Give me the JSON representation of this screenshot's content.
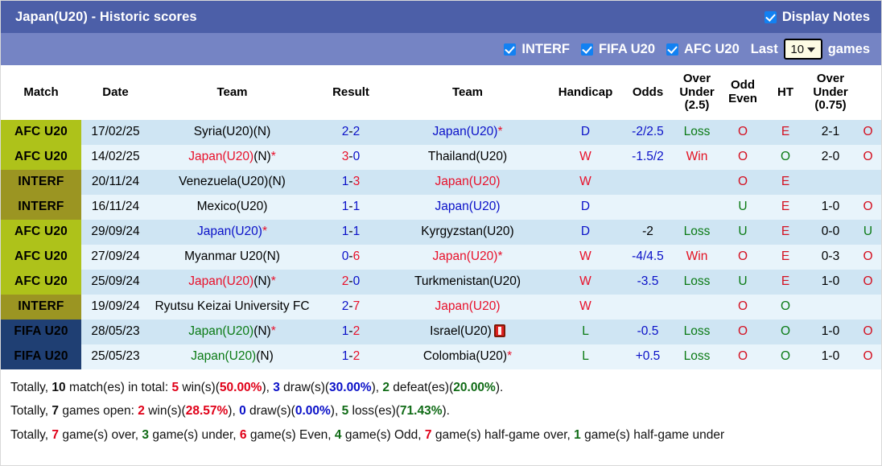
{
  "titlebar": {
    "title": "Japan(U20) - Historic scores",
    "display_notes_label": "Display Notes",
    "display_notes_checked": true
  },
  "filterbar": {
    "filters": [
      {
        "label": "INTERF",
        "checked": true
      },
      {
        "label": "FIFA U20",
        "checked": true
      },
      {
        "label": "AFC U20",
        "checked": true
      }
    ],
    "last_label": "Last",
    "games_label": "games",
    "select_value": "10"
  },
  "table": {
    "headers": [
      "Match",
      "Date",
      "Team",
      "Result",
      "Team",
      "Handicap",
      "Odds",
      "Over\nUnder\n(2.5)",
      "Odd\nEven",
      "HT",
      "Over\nUnder\n(0.75)"
    ],
    "headers_flat": {
      "match": "Match",
      "date": "Date",
      "team_home": "Team",
      "result": "Result",
      "team_away": "Team",
      "handicap": "Handicap",
      "odds": "Odds",
      "ou25_l1": "Over",
      "ou25_l2": "Under",
      "ou25_l3": "(2.5)",
      "oe_l1": "Odd",
      "oe_l2": "Even",
      "ht": "HT",
      "ou075_l1": "Over",
      "ou075_l2": "Under",
      "ou075_l3": "(0.75)"
    },
    "rows": [
      {
        "match": "AFC U20",
        "match_type": "afc",
        "date": "17/02/25",
        "home": {
          "name": "Syria(U20)",
          "color": "black",
          "suffix": "(N)",
          "star": false
        },
        "score": {
          "home": "2",
          "away": "2",
          "home_color": "blue",
          "away_color": "blue"
        },
        "away": {
          "name": "Japan(U20)",
          "color": "blue",
          "suffix": "",
          "star": true,
          "redcard": false
        },
        "wdl": "D",
        "wdl_color": "blue",
        "handicap": "-2/2.5",
        "handicap_color": "blue",
        "odds": "Loss",
        "odds_color": "loss",
        "ou25": "O",
        "oe": "E",
        "ht": "2-1",
        "ou075": "O"
      },
      {
        "match": "AFC U20",
        "match_type": "afc",
        "date": "14/02/25",
        "home": {
          "name": "Japan(U20)",
          "color": "red",
          "suffix": "(N)",
          "star": true
        },
        "score": {
          "home": "3",
          "away": "0",
          "home_color": "red",
          "away_color": "blue"
        },
        "away": {
          "name": "Thailand(U20)",
          "color": "black",
          "suffix": "",
          "star": false,
          "redcard": false
        },
        "wdl": "W",
        "wdl_color": "red",
        "handicap": "-1.5/2",
        "handicap_color": "blue",
        "odds": "Win",
        "odds_color": "win",
        "ou25": "O",
        "oe": "O",
        "ht": "2-0",
        "ou075": "O"
      },
      {
        "match": "INTERF",
        "match_type": "interf",
        "date": "20/11/24",
        "home": {
          "name": "Venezuela(U20)",
          "color": "black",
          "suffix": "(N)",
          "star": false
        },
        "score": {
          "home": "1",
          "away": "3",
          "home_color": "blue",
          "away_color": "red"
        },
        "away": {
          "name": "Japan(U20)",
          "color": "red",
          "suffix": "",
          "star": false,
          "redcard": false
        },
        "wdl": "W",
        "wdl_color": "red",
        "handicap": "",
        "handicap_color": "blue",
        "odds": "",
        "odds_color": "none",
        "ou25": "O",
        "oe": "E",
        "ht": "",
        "ou075": ""
      },
      {
        "match": "INTERF",
        "match_type": "interf",
        "date": "16/11/24",
        "home": {
          "name": "Mexico(U20)",
          "color": "black",
          "suffix": "",
          "star": false
        },
        "score": {
          "home": "1",
          "away": "1",
          "home_color": "blue",
          "away_color": "blue"
        },
        "away": {
          "name": "Japan(U20)",
          "color": "blue",
          "suffix": "",
          "star": false,
          "redcard": false
        },
        "wdl": "D",
        "wdl_color": "blue",
        "handicap": "",
        "handicap_color": "blue",
        "odds": "",
        "odds_color": "none",
        "ou25": "U",
        "oe": "E",
        "ht": "1-0",
        "ou075": "O"
      },
      {
        "match": "AFC U20",
        "match_type": "afc",
        "date": "29/09/24",
        "home": {
          "name": "Japan(U20)",
          "color": "blue",
          "suffix": "",
          "star": true
        },
        "score": {
          "home": "1",
          "away": "1",
          "home_color": "blue",
          "away_color": "blue"
        },
        "away": {
          "name": "Kyrgyzstan(U20)",
          "color": "black",
          "suffix": "",
          "star": false,
          "redcard": false
        },
        "wdl": "D",
        "wdl_color": "blue",
        "handicap": "-2",
        "handicap_color": "black",
        "odds": "Loss",
        "odds_color": "loss",
        "ou25": "U",
        "oe": "E",
        "ht": "0-0",
        "ou075": "U"
      },
      {
        "match": "AFC U20",
        "match_type": "afc",
        "date": "27/09/24",
        "home": {
          "name": "Myanmar U20",
          "color": "black",
          "suffix": "(N)",
          "star": false
        },
        "score": {
          "home": "0",
          "away": "6",
          "home_color": "blue",
          "away_color": "red"
        },
        "away": {
          "name": "Japan(U20)",
          "color": "red",
          "suffix": "",
          "star": true,
          "redcard": false
        },
        "wdl": "W",
        "wdl_color": "red",
        "handicap": "-4/4.5",
        "handicap_color": "blue",
        "odds": "Win",
        "odds_color": "win",
        "ou25": "O",
        "oe": "E",
        "ht": "0-3",
        "ou075": "O"
      },
      {
        "match": "AFC U20",
        "match_type": "afc",
        "date": "25/09/24",
        "home": {
          "name": "Japan(U20)",
          "color": "red",
          "suffix": "(N)",
          "star": true
        },
        "score": {
          "home": "2",
          "away": "0",
          "home_color": "red",
          "away_color": "blue"
        },
        "away": {
          "name": "Turkmenistan(U20)",
          "color": "black",
          "suffix": "",
          "star": false,
          "redcard": false
        },
        "wdl": "W",
        "wdl_color": "red",
        "handicap": "-3.5",
        "handicap_color": "blue",
        "odds": "Loss",
        "odds_color": "loss",
        "ou25": "U",
        "oe": "E",
        "ht": "1-0",
        "ou075": "O"
      },
      {
        "match": "INTERF",
        "match_type": "interf",
        "date": "19/09/24",
        "home": {
          "name": "Ryutsu Keizai University FC",
          "color": "black",
          "suffix": "",
          "star": false
        },
        "score": {
          "home": "2",
          "away": "7",
          "home_color": "blue",
          "away_color": "red"
        },
        "away": {
          "name": "Japan(U20)",
          "color": "red",
          "suffix": "",
          "star": false,
          "redcard": false
        },
        "wdl": "W",
        "wdl_color": "red",
        "handicap": "",
        "handicap_color": "blue",
        "odds": "",
        "odds_color": "none",
        "ou25": "O",
        "oe": "O",
        "ht": "",
        "ou075": ""
      },
      {
        "match": "FIFA U20",
        "match_type": "fifa",
        "date": "28/05/23",
        "home": {
          "name": "Japan(U20)",
          "color": "green",
          "suffix": "(N)",
          "star": true
        },
        "score": {
          "home": "1",
          "away": "2",
          "home_color": "blue",
          "away_color": "red"
        },
        "away": {
          "name": "Israel(U20)",
          "color": "black",
          "suffix": "",
          "star": false,
          "redcard": true
        },
        "wdl": "L",
        "wdl_color": "green",
        "handicap": "-0.5",
        "handicap_color": "blue",
        "odds": "Loss",
        "odds_color": "loss",
        "ou25": "O",
        "oe": "O",
        "ht": "1-0",
        "ou075": "O"
      },
      {
        "match": "FIFA U20",
        "match_type": "fifa",
        "date": "25/05/23",
        "home": {
          "name": "Japan(U20)",
          "color": "green",
          "suffix": "(N)",
          "star": false
        },
        "score": {
          "home": "1",
          "away": "2",
          "home_color": "blue",
          "away_color": "red"
        },
        "away": {
          "name": "Colombia(U20)",
          "color": "black",
          "suffix": "",
          "star": true,
          "redcard": false
        },
        "wdl": "L",
        "wdl_color": "green",
        "handicap": "+0.5",
        "handicap_color": "blue",
        "odds": "Loss",
        "odds_color": "loss",
        "ou25": "O",
        "oe": "O",
        "ht": "1-0",
        "ou075": "O"
      }
    ]
  },
  "footer": {
    "line1": {
      "p1": "Totally, ",
      "n_total": "10",
      "p2": " match(es) in total: ",
      "n_win": "5",
      "p3": " win(s)(",
      "pct_win": "50.00%",
      "p4": "), ",
      "n_draw": "3",
      "p5": " draw(s)(",
      "pct_draw": "30.00%",
      "p6": "), ",
      "n_def": "2",
      "p7": " defeat(es)(",
      "pct_def": "20.00%",
      "p8": ")."
    },
    "line2": {
      "p1": "Totally, ",
      "n_total": "7",
      "p2": " games open: ",
      "n_win": "2",
      "p3": " win(s)(",
      "pct_win": "28.57%",
      "p4": "), ",
      "n_draw": "0",
      "p5": " draw(s)(",
      "pct_draw": "0.00%",
      "p6": "), ",
      "n_loss": "5",
      "p7": " loss(es)(",
      "pct_loss": "71.43%",
      "p8": ")."
    },
    "line3": {
      "p1": "Totally, ",
      "n_over": "7",
      "p2": " game(s) over, ",
      "n_under": "3",
      "p3": " game(s) under, ",
      "n_even": "6",
      "p4": " game(s) Even, ",
      "n_odd": "4",
      "p5": " game(s) Odd, ",
      "n_half_over": "7",
      "p6": " game(s) half-game over, ",
      "n_half_under": "1",
      "p7": " game(s) half-game under"
    }
  },
  "colors": {
    "titlebar_bg": "#4c5fa8",
    "filterbar_bg": "#7584c4",
    "afc_bg": "#aec21a",
    "interf_bg": "#9b9522",
    "fifa_bg": "#1f3f73",
    "row_odd": "#cfe5f3",
    "row_even": "#e8f4fb",
    "red": "#e8102a",
    "blue": "#0a10c8",
    "green": "#0a7a14"
  }
}
